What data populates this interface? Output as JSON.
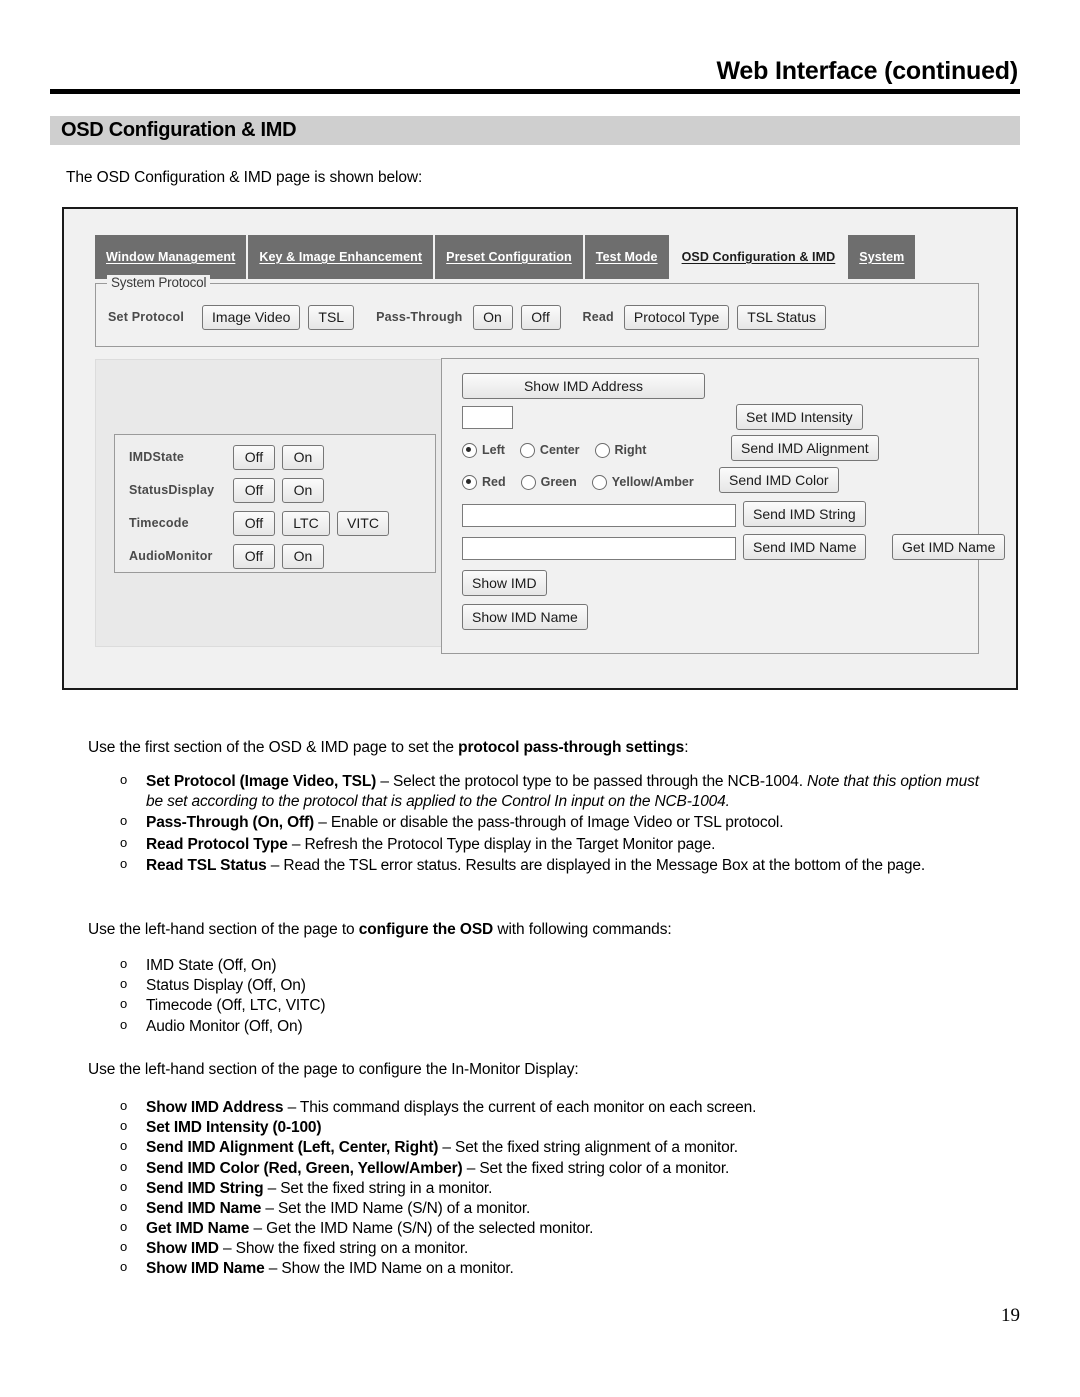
{
  "header": {
    "title": "Web Interface (continued)"
  },
  "section": {
    "heading": "OSD Configuration & IMD",
    "intro": "The OSD Configuration & IMD page is shown below:"
  },
  "figure": {
    "tabs": [
      {
        "label": "Window Management",
        "active": false
      },
      {
        "label": "Key & Image Enhancement",
        "active": false
      },
      {
        "label": "Preset Configuration",
        "active": false
      },
      {
        "label": "Test Mode",
        "active": false
      },
      {
        "label": "OSD Configuration & IMD",
        "active": true
      },
      {
        "label": "System",
        "active": false
      }
    ],
    "system_protocol": {
      "legend": "System Protocol",
      "set_protocol_label": "Set Protocol",
      "set_protocol_buttons": [
        "Image Video",
        "TSL"
      ],
      "pass_through_label": "Pass-Through",
      "pass_through_buttons": [
        "On",
        "Off"
      ],
      "read_label": "Read",
      "read_buttons": [
        "Protocol Type",
        "TSL Status"
      ]
    },
    "osd_options": [
      {
        "label": "IMDState",
        "buttons": [
          "Off",
          "On"
        ]
      },
      {
        "label": "StatusDisplay",
        "buttons": [
          "Off",
          "On"
        ]
      },
      {
        "label": "Timecode",
        "buttons": [
          "Off",
          "LTC",
          "VITC"
        ]
      },
      {
        "label": "AudioMonitor",
        "buttons": [
          "Off",
          "On"
        ]
      }
    ],
    "imd_panel": {
      "show_imd_address_button": "Show IMD Address",
      "intensity_value": "",
      "set_imd_intensity_button": "Set IMD Intensity",
      "alignment_options": [
        {
          "label": "Left",
          "selected": true
        },
        {
          "label": "Center",
          "selected": false
        },
        {
          "label": "Right",
          "selected": false
        }
      ],
      "send_imd_alignment_button": "Send IMD Alignment",
      "color_options": [
        {
          "label": "Red",
          "selected": true
        },
        {
          "label": "Green",
          "selected": false
        },
        {
          "label": "Yellow/Amber",
          "selected": false
        }
      ],
      "send_imd_color_button": "Send IMD Color",
      "imd_string_value": "",
      "send_imd_string_button": "Send IMD String",
      "imd_name_value": "",
      "send_imd_name_button": "Send IMD Name",
      "get_imd_name_button": "Get IMD Name",
      "show_imd_button": "Show IMD",
      "show_imd_name_button": "Show IMD Name"
    }
  },
  "prose": {
    "lead_protocol_1": "Use the first section of the OSD & IMD page to set the ",
    "lead_protocol_bold": "protocol pass-through settings",
    "lead_protocol_2": ":",
    "protocol_bullets": [
      {
        "bold": "Set Protocol (Image Video, TSL)",
        "rest": " – Select the protocol type to be passed through the NCB-1004. ",
        "italic": "Note that this option must be set according to the protocol that is applied to the Control In input on the NCB-1004."
      },
      {
        "bold": "Pass-Through (On, Off)",
        "rest": " – Enable or disable the pass-through of Image Video or TSL protocol.",
        "italic": ""
      },
      {
        "bold": "Read Protocol Type",
        "rest": " – Refresh the Protocol Type display in the Target Monitor page.",
        "italic": ""
      },
      {
        "bold": "Read TSL Status",
        "rest": " – Read the TSL error status. Results are displayed in the Message Box at the bottom of the page.",
        "italic": ""
      }
    ],
    "lead_osd_1": "Use the left-hand section of the page to ",
    "lead_osd_bold": "configure the OSD",
    "lead_osd_2": " with following commands:",
    "osd_bullets": [
      "IMD State (Off, On)",
      "Status Display (Off, On)",
      "Timecode (Off, LTC, VITC)",
      "Audio Monitor (Off, On)"
    ],
    "lead_imd": "Use the left-hand section of the page to configure the In-Monitor Display:",
    "imd_bullets": [
      {
        "bold": "Show IMD Address",
        "rest": " – This command displays the current of each monitor on each screen."
      },
      {
        "bold": "Set IMD Intensity (0-100)",
        "rest": ""
      },
      {
        "bold": "Send IMD Alignment (Left, Center, Right)",
        "rest": " – Set the fixed string alignment of a monitor."
      },
      {
        "bold": "Send IMD Color (Red, Green, Yellow/Amber)",
        "rest": " – Set the fixed string color of a monitor."
      },
      {
        "bold": "Send IMD String",
        "rest": " – Set the fixed string in a monitor."
      },
      {
        "bold": "Send IMD Name",
        "rest": " – Set the IMD Name (S/N) of a monitor."
      },
      {
        "bold": "Get IMD Name",
        "rest": " – Get the IMD Name (S/N) of the selected monitor."
      },
      {
        "bold": "Show IMD",
        "rest": " – Show the fixed string on a monitor."
      },
      {
        "bold": "Show IMD Name",
        "rest": " – Show the IMD Name on a monitor."
      }
    ]
  },
  "footer": {
    "page_number": "19"
  }
}
